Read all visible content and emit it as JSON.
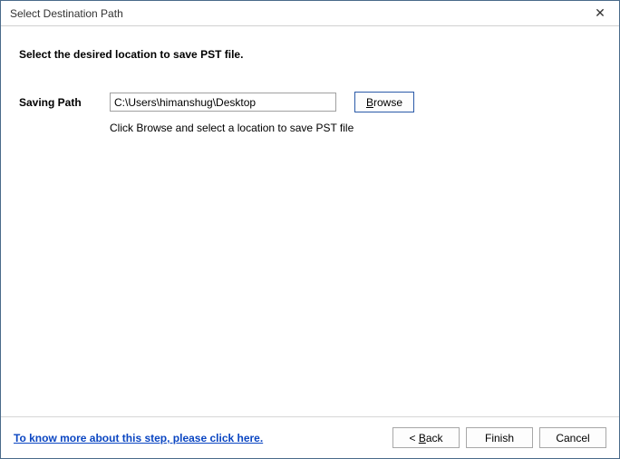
{
  "titlebar": {
    "title": "Select Destination Path"
  },
  "content": {
    "heading": "Select the desired location to save PST file.",
    "path_label": "Saving Path",
    "path_value": "C:\\Users\\himanshug\\Desktop",
    "browse_prefix": "B",
    "browse_rest": "rowse",
    "hint": "Click Browse and select a location to save PST file"
  },
  "footer": {
    "help_link": "To know more about this step, please click here.",
    "back_prefix": "< ",
    "back_mn": "B",
    "back_rest": "ack",
    "finish_label": "Finish",
    "cancel_label": "Cancel"
  }
}
